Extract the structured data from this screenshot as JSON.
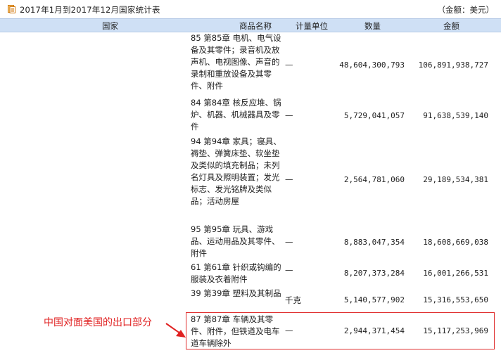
{
  "title": "2017年1月到2017年12月国家统计表",
  "amount_unit": "（金额：美元）",
  "columns": [
    "国家",
    "商品名称",
    "计量单位",
    "数量",
    "金额"
  ],
  "rows": [
    {
      "name": "85 第85章 电机、电气设备及其零件；录音机及放声机、电视图像、声音的录制和重放设备及其零件、附件",
      "unit": "—",
      "qty": "48,604,300,793",
      "amount": "106,891,938,727"
    },
    {
      "name": "84 第84章 核反应堆、锅炉、机器、机械器具及零件",
      "unit": "—",
      "qty": "5,729,041,057",
      "amount": "91,638,539,140"
    },
    {
      "name": "94 第94章 家具；寝具、褥垫、弹簧床垫、软坐垫及类似的填充制品；未列名灯具及照明装置；发光标志、发光铭牌及类似品；活动房屋",
      "unit": "—",
      "qty": "2,564,781,060",
      "amount": "29,189,534,381"
    },
    {
      "name": "95 第95章 玩具、游戏品、运动用品及其零件、附件",
      "unit": "—",
      "qty": "8,883,047,354",
      "amount": "18,608,669,038"
    },
    {
      "name": "61 第61章 针织或钩编的服装及衣着附件",
      "unit": "—",
      "qty": "8,207,373,284",
      "amount": "16,001,266,531"
    },
    {
      "name": "39 第39章 塑料及其制品",
      "unit": "千克",
      "qty": "5,140,577,902",
      "amount": "15,316,553,650"
    },
    {
      "name": "87 第87章 车辆及其零件、附件，但铁道及电车道车辆除外",
      "unit": "—",
      "qty": "2,944,371,454",
      "amount": "15,117,253,969"
    }
  ],
  "annotation": "中国对面美国的出口部分"
}
